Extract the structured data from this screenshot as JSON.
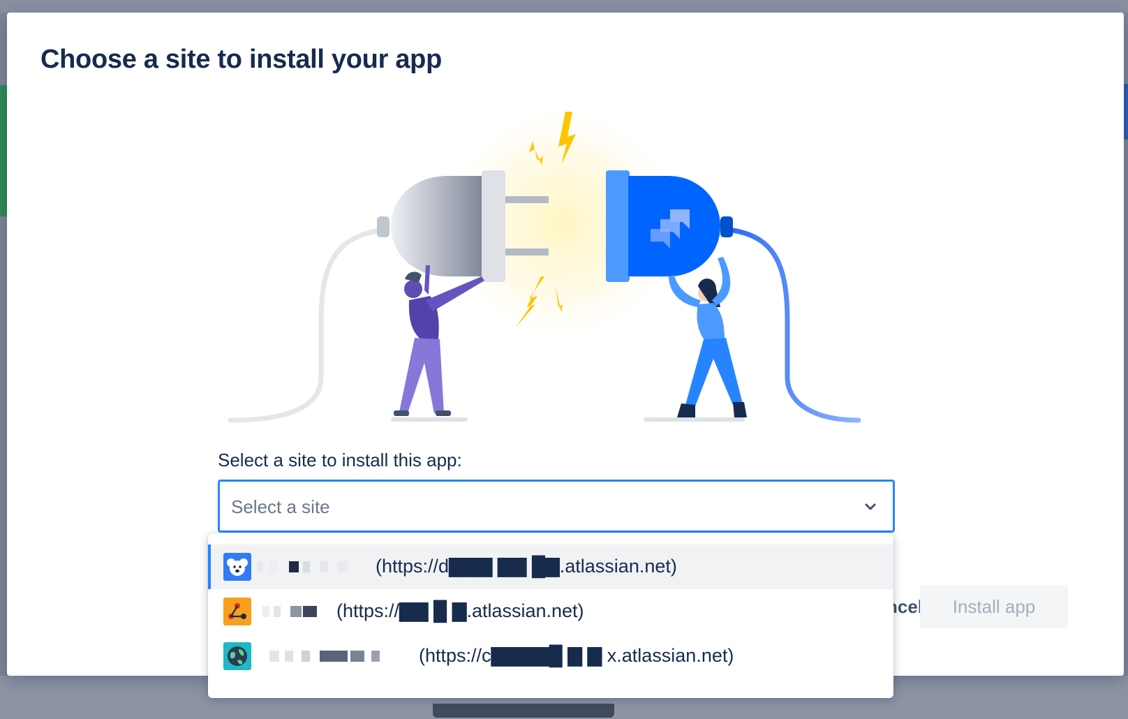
{
  "dialog": {
    "title": "Choose a site to install your app",
    "site_label": "Select a site to install this app:",
    "select_placeholder": "Select a site",
    "cancel_label": "Cancel",
    "install_label": "Install app"
  },
  "dropdown": {
    "options": [
      {
        "label": "(https://d▇▇▇ ▇▇ █▇.atlassian.net)",
        "avatar": "koala-avatar-icon",
        "active": true
      },
      {
        "label": "(https://▇▇ █ ▇.atlassian.net)",
        "avatar": "webhook-avatar-icon",
        "active": false
      },
      {
        "label": "(https://c▇▇▇▇█ ▇ ▇ x.atlassian.net)",
        "avatar": "globe-avatar-icon",
        "active": false
      }
    ]
  },
  "colors": {
    "accent": "#2684ff",
    "title": "#172b4d",
    "jira_blue": "#0065ff"
  }
}
